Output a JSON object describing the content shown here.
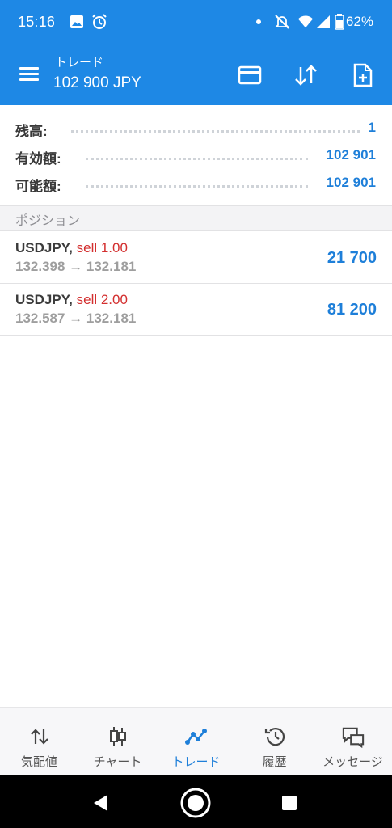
{
  "status_bar": {
    "time": "15:16",
    "battery": "62%"
  },
  "app_bar": {
    "title": "トレード",
    "subtitle": "102 900 JPY"
  },
  "balance": [
    {
      "label": "残高:",
      "value": "1"
    },
    {
      "label": "有効額:",
      "value": "102 901"
    },
    {
      "label": "可能額:",
      "value": "102 901"
    }
  ],
  "positions": {
    "header": "ポジション",
    "items": [
      {
        "symbol": "USDJPY,",
        "side": "sell 1.00",
        "prices": "132.398 → 132.181",
        "profit": "21 700"
      },
      {
        "symbol": "USDJPY,",
        "side": "sell 2.00",
        "prices": "132.587 → 132.181",
        "profit": "81 200"
      }
    ]
  },
  "bottom_nav": {
    "tabs": [
      {
        "label": "気配値",
        "icon": "quotes-icon"
      },
      {
        "label": "チャート",
        "icon": "candlestick-chart-icon"
      },
      {
        "label": "トレード",
        "icon": "trade-line-icon"
      },
      {
        "label": "履歴",
        "icon": "history-icon"
      },
      {
        "label": "メッセージ",
        "icon": "messages-icon"
      }
    ],
    "active_index": 2
  },
  "colors": {
    "primary": "#1e88e5",
    "value_blue": "#1e7fd9",
    "sell_red": "#d32f2f"
  }
}
